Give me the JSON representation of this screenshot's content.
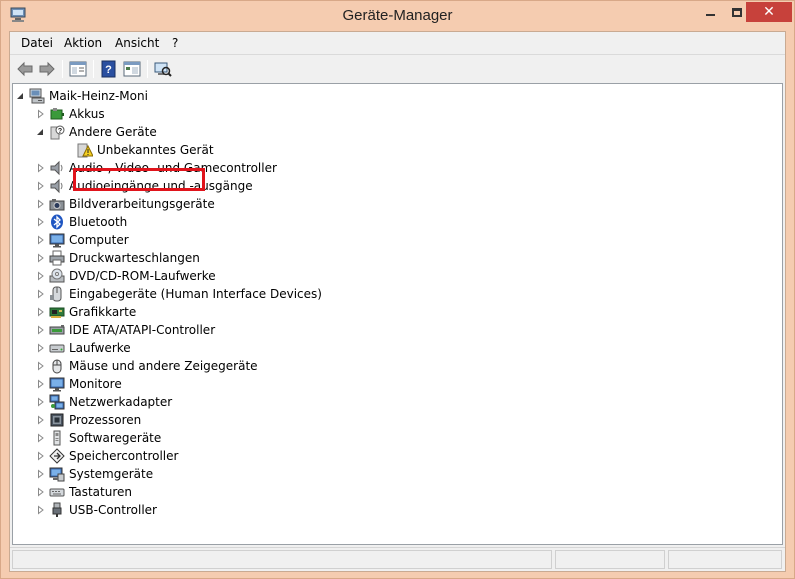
{
  "window": {
    "title": "Geräte-Manager"
  },
  "menu": {
    "items": [
      "Datei",
      "Aktion",
      "Ansicht",
      "?"
    ]
  },
  "toolbar": {
    "buttons": [
      "back-arrow-icon",
      "forward-arrow-icon",
      "properties-icon",
      "help-icon",
      "view-icon",
      "scan-hardware-icon"
    ]
  },
  "tree": {
    "root": "Maik-Heinz-Moni",
    "categories": [
      {
        "label": "Akkus",
        "icon": "battery-icon",
        "expanded": false
      },
      {
        "label": "Andere Geräte",
        "icon": "unknown-device-icon",
        "expanded": true,
        "children": [
          {
            "label": "Unbekanntes Gerät",
            "icon": "warning-device-icon",
            "highlighted": true
          }
        ]
      },
      {
        "label": "Audio-, Video- und Gamecontroller",
        "icon": "speaker-icon",
        "expanded": false
      },
      {
        "label": "Audioeingänge und -ausgänge",
        "icon": "speaker-icon",
        "expanded": false
      },
      {
        "label": "Bildverarbeitungsgeräte",
        "icon": "camera-icon",
        "expanded": false
      },
      {
        "label": "Bluetooth",
        "icon": "bluetooth-icon",
        "expanded": false
      },
      {
        "label": "Computer",
        "icon": "monitor-icon",
        "expanded": false
      },
      {
        "label": "Druckwarteschlangen",
        "icon": "printer-icon",
        "expanded": false
      },
      {
        "label": "DVD/CD-ROM-Laufwerke",
        "icon": "disc-drive-icon",
        "expanded": false
      },
      {
        "label": "Eingabegeräte (Human Interface Devices)",
        "icon": "hid-icon",
        "expanded": false
      },
      {
        "label": "Grafikkarte",
        "icon": "display-adapter-icon",
        "expanded": false
      },
      {
        "label": "IDE ATA/ATAPI-Controller",
        "icon": "ide-controller-icon",
        "expanded": false
      },
      {
        "label": "Laufwerke",
        "icon": "hard-drive-icon",
        "expanded": false
      },
      {
        "label": "Mäuse und andere Zeigegeräte",
        "icon": "mouse-icon",
        "expanded": false
      },
      {
        "label": "Monitore",
        "icon": "monitor-icon",
        "expanded": false
      },
      {
        "label": "Netzwerkadapter",
        "icon": "network-adapter-icon",
        "expanded": false
      },
      {
        "label": "Prozessoren",
        "icon": "processor-icon",
        "expanded": false
      },
      {
        "label": "Softwaregeräte",
        "icon": "software-device-icon",
        "expanded": false
      },
      {
        "label": "Speichercontroller",
        "icon": "storage-controller-icon",
        "expanded": false
      },
      {
        "label": "Systemgeräte",
        "icon": "system-device-icon",
        "expanded": false
      },
      {
        "label": "Tastaturen",
        "icon": "keyboard-icon",
        "expanded": false
      },
      {
        "label": "USB-Controller",
        "icon": "usb-icon",
        "expanded": false
      }
    ]
  },
  "colors": {
    "titlebar": "#f5ccb0",
    "close_button": "#c7413b",
    "highlight_border": "#e0141c"
  }
}
